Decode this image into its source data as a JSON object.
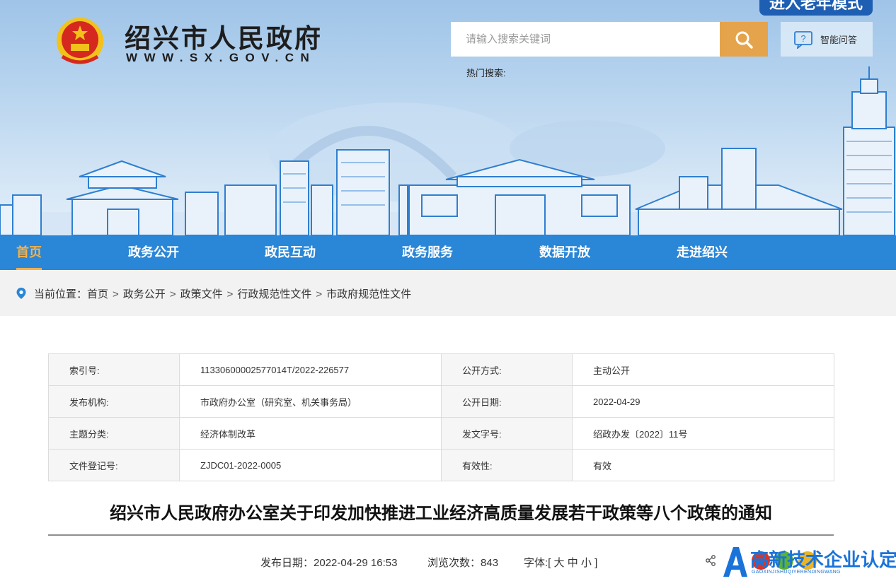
{
  "header": {
    "site_title": "绍兴市人民政府",
    "site_domain": "WWW.SX.GOV.CN",
    "elder_mode": "进入老年模式",
    "search_placeholder": "请输入搜索关键词",
    "ai_label": "智能问答",
    "hot_search_label": "热门搜索:"
  },
  "nav": {
    "items": [
      {
        "label": "首页",
        "active": true
      },
      {
        "label": "政务公开"
      },
      {
        "label": "政民互动"
      },
      {
        "label": "政务服务"
      },
      {
        "label": "数据开放"
      },
      {
        "label": "走进绍兴"
      }
    ]
  },
  "breadcrumb": {
    "prefix": "当前位置：",
    "items": [
      "首页",
      "政务公开",
      "政策文件",
      "行政规范性文件",
      "市政府规范性文件"
    ],
    "separator": ">"
  },
  "info_table": {
    "rows": [
      {
        "k1": "索引号:",
        "v1": "11330600002577014T/2022-226577",
        "k2": "公开方式:",
        "v2": "主动公开"
      },
      {
        "k1": "发布机构:",
        "v1": "市政府办公室（研究室、机关事务局）",
        "k2": "公开日期:",
        "v2": "2022-04-29"
      },
      {
        "k1": "主题分类:",
        "v1": "经济体制改革",
        "k2": "发文字号:",
        "v2": "绍政办发〔2022〕11号"
      },
      {
        "k1": "文件登记号:",
        "v1": "ZJDC01-2022-0005",
        "k2": "有效性:",
        "v2": "有效"
      }
    ]
  },
  "article": {
    "title": "绍兴市人民政府办公室关于印发加快推进工业经济高质量发展若干政策等八个政策的通知",
    "publish_label": "发布日期：",
    "publish_value": "2022-04-29 16:53",
    "views_label": "浏览次数：",
    "views_value": "843",
    "font_label": "字体:[",
    "font_large": "大",
    "font_medium": "中",
    "font_small": "小",
    "font_close": "]"
  },
  "watermark": {
    "text": "高新技术企业认定网",
    "sub": "GAOXINJISHUQIYERENDINGWANG"
  },
  "colors": {
    "nav_bg": "#2a86d6",
    "nav_active": "#f3b24e",
    "search_btn": "#e5a34c",
    "elder_btn": "#1e5fb3",
    "share_red": "#d9352b",
    "share_green": "#5cb330",
    "share_yellow": "#e9b42a"
  },
  "icons": {
    "search": "magnifier-icon",
    "ai": "question-bubble-icon",
    "breadcrumb": "location-pin-icon",
    "share": "share-icon"
  }
}
